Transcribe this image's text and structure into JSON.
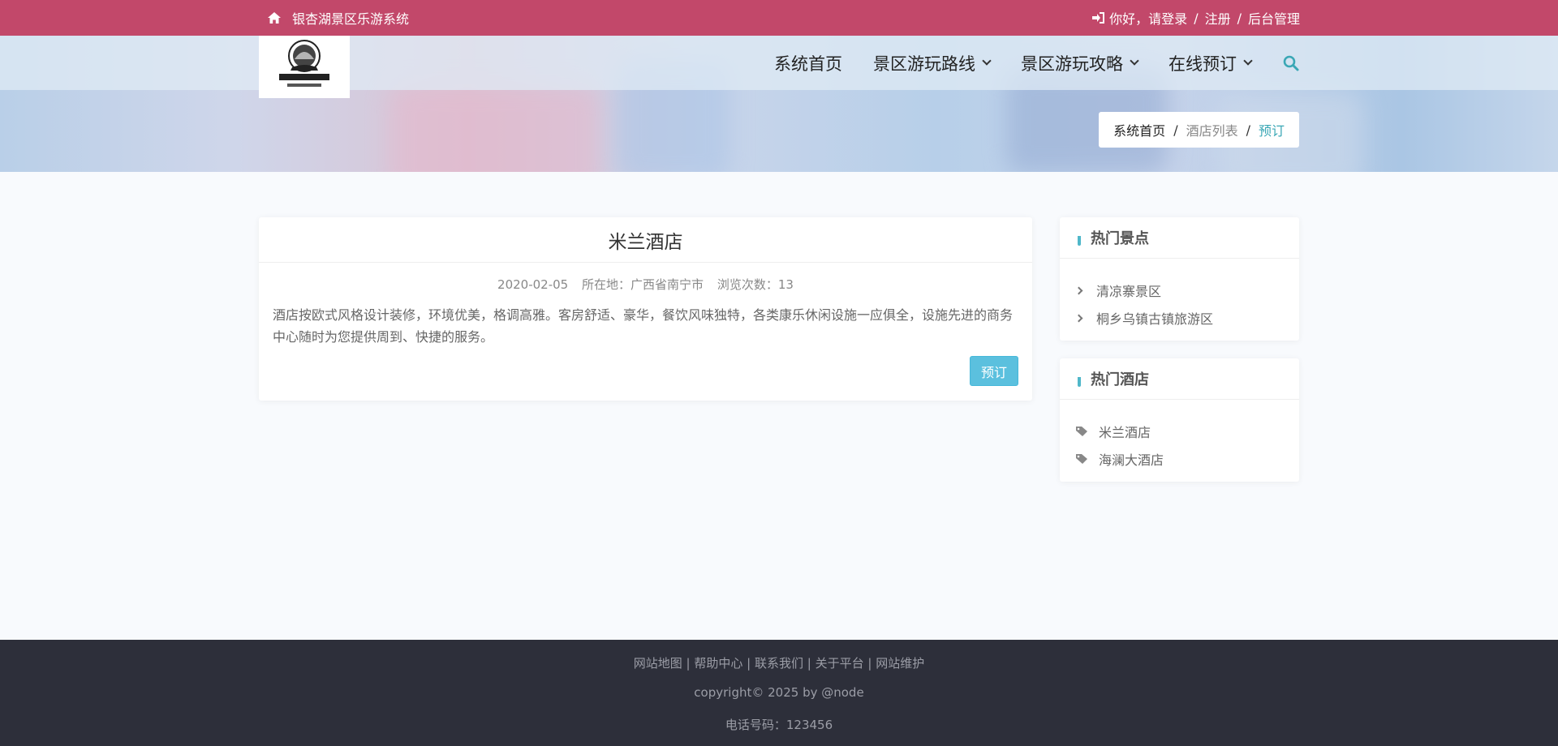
{
  "topbar": {
    "site_title": "银杏湖景区乐游系统",
    "greeting": "你好，请登录",
    "register": "注册",
    "admin": "后台管理",
    "sep": "/"
  },
  "nav": {
    "items": [
      {
        "label": "系统首页",
        "dropdown": false
      },
      {
        "label": "景区游玩路线",
        "dropdown": true
      },
      {
        "label": "景区游玩攻略",
        "dropdown": true
      },
      {
        "label": "在线预订",
        "dropdown": true
      }
    ],
    "search_icon": "search-icon"
  },
  "breadcrumb": {
    "home": "系统首页",
    "list": "酒店列表",
    "current": "预订",
    "sep": "/"
  },
  "hotel": {
    "name": "米兰酒店",
    "date": "2020-02-05",
    "location_label": "所在地：",
    "location": "广西省南宁市",
    "views_label": "浏览次数：",
    "views": "13",
    "description": "酒店按欧式风格设计装修，环境优美，格调高雅。客房舒适、豪华，餐饮风味独特，各类康乐休闲设施一应俱全，设施先进的商务中心随时为您提供周到、快捷的服务。",
    "book_label": "预订"
  },
  "sidebar": {
    "spots": {
      "title": "热门景点",
      "items": [
        "清凉寨景区",
        "桐乡乌镇古镇旅游区"
      ]
    },
    "hotels": {
      "title": "热门酒店",
      "items": [
        "米兰酒店",
        "海澜大酒店"
      ]
    }
  },
  "footer": {
    "links": [
      "网站地图",
      "帮助中心",
      "联系我们",
      "关于平台",
      "网站维护"
    ],
    "copyright": "copyright© 2025 by @node",
    "phone": "电话号码：123456"
  },
  "colors": {
    "topbar": "#c2486a",
    "accent": "#3aa7b5",
    "button": "#5bc0de",
    "footer": "#2d2f3a"
  }
}
